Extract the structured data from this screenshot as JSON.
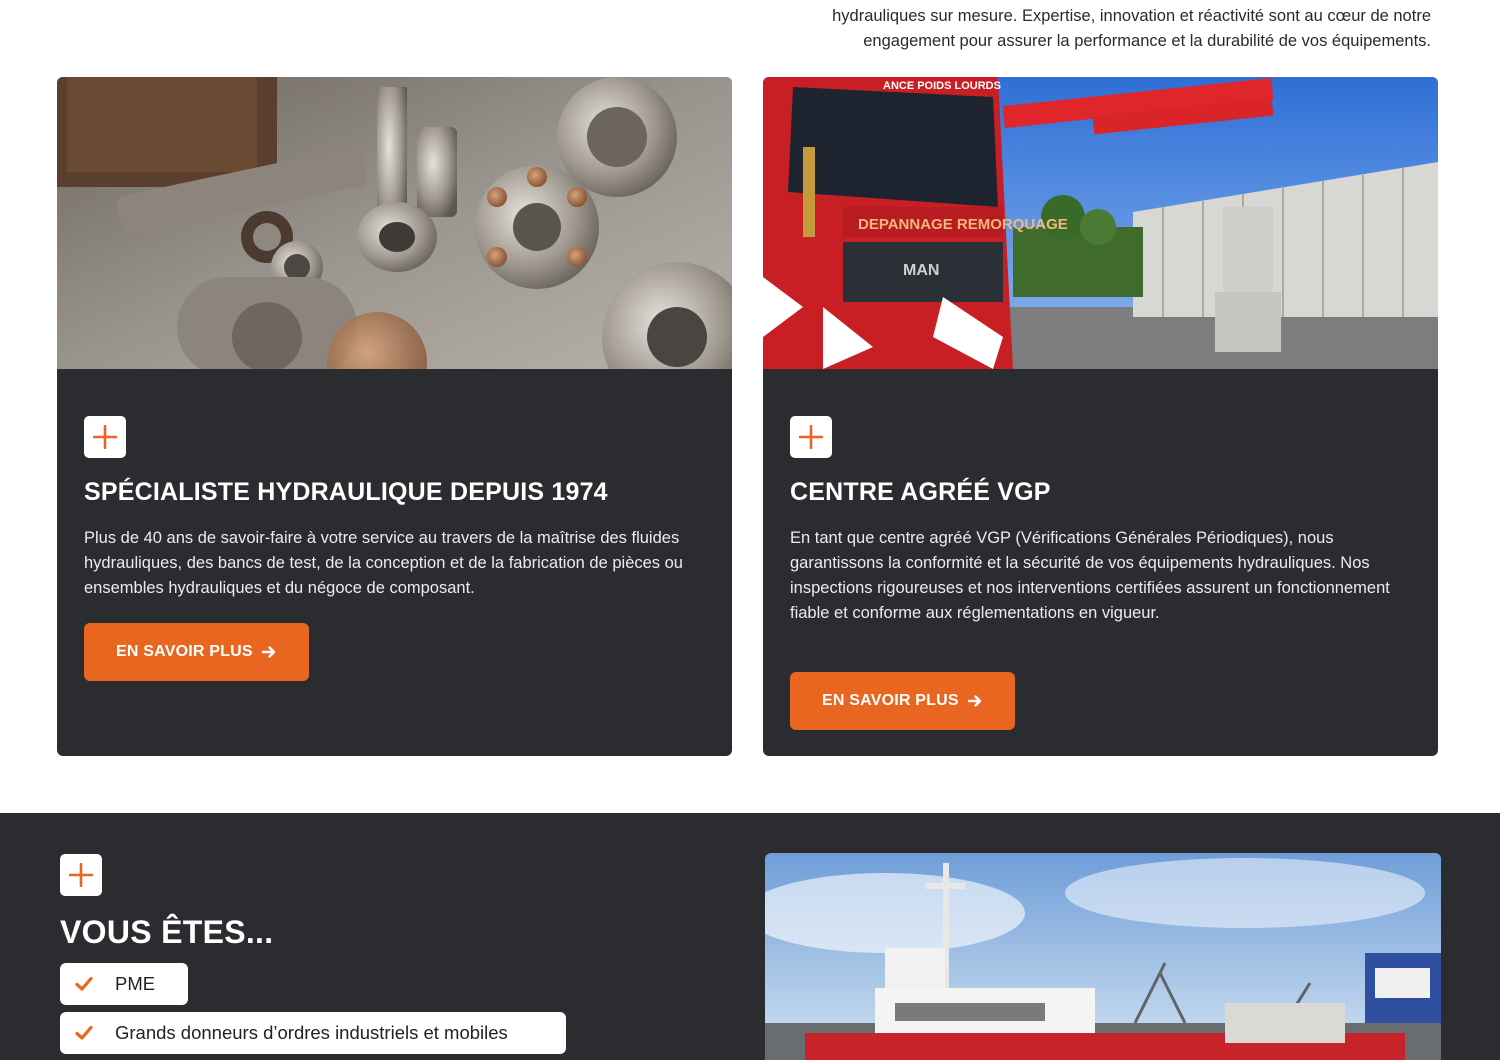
{
  "intro": {
    "line1": "hydrauliques sur mesure. Expertise, innovation et réactivité sont au cœur de notre",
    "line2": "engagement pour assurer la performance et la durabilité de vos équipements."
  },
  "cards": [
    {
      "title": "SPÉCIALISTE HYDRAULIQUE DEPUIS 1974",
      "text": "Plus de 40 ans de savoir-faire à votre service au travers de la maîtrise des fluides hydrauliques, des bancs de test, de la conception et de la fabrication de pièces ou ensembles hydrauliques et du négoce de composant.",
      "button": "EN SAVOIR PLUS",
      "image": "hydraulic-parts-photo"
    },
    {
      "title": "CENTRE AGRÉÉ VGP",
      "text": "En tant que centre agréé VGP (Vérifications Générales Périodiques), nous garantissons la conformité et la sécurité de vos équipements hydrauliques. Nos inspections rigoureuses et nos interventions certifiées assurent un fonctionnement fiable et conforme aux réglementations en vigueur.",
      "button": "EN SAVOIR PLUS",
      "image": "tow-truck-crane-photo",
      "truck_text": "DEPANNAGE REMORQUAGE",
      "truck_brand": "MAN",
      "truck_top": "ANCE POIDS LOURDS"
    }
  ],
  "section2": {
    "title": "VOUS ÊTES...",
    "items": [
      "PME",
      "Grands donneurs d’ordres industriels et mobiles"
    ],
    "image": "ship-harbor-photo"
  },
  "colors": {
    "accent": "#e8661f",
    "dark": "#2b2c2f",
    "white": "#ffffff"
  },
  "icons": [
    "plus-icon",
    "arrow-right-icon",
    "check-icon"
  ]
}
